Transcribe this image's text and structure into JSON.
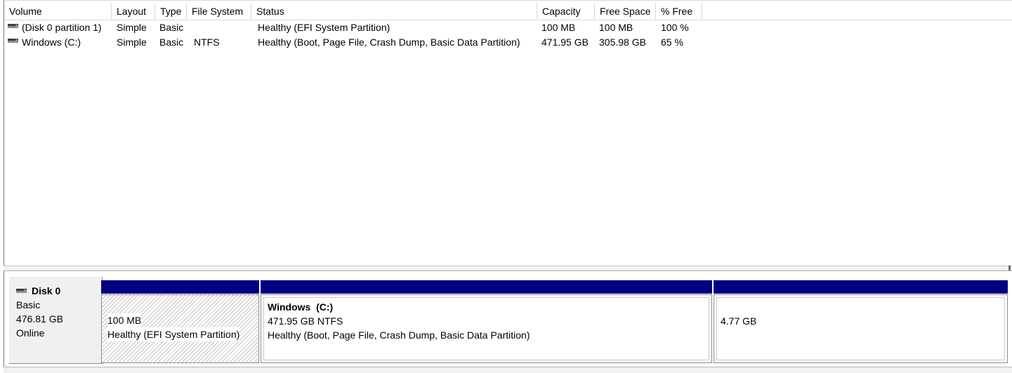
{
  "columns": {
    "volume": "Volume",
    "layout": "Layout",
    "type": "Type",
    "file_system": "File System",
    "status": "Status",
    "capacity": "Capacity",
    "free_space": "Free Space",
    "percent_free": "% Free"
  },
  "volumes": [
    {
      "volume": "(Disk 0 partition 1)",
      "layout": "Simple",
      "type": "Basic",
      "file_system": "",
      "status": "Healthy (EFI System Partition)",
      "capacity": "100 MB",
      "free_space": "100 MB",
      "percent_free": "100 %"
    },
    {
      "volume": "Windows (C:)",
      "layout": "Simple",
      "type": "Basic",
      "file_system": "NTFS",
      "status": "Healthy (Boot, Page File, Crash Dump, Basic Data Partition)",
      "capacity": "471.95 GB",
      "free_space": "305.98 GB",
      "percent_free": "65 %"
    }
  ],
  "disk": {
    "name": "Disk 0",
    "type": "Basic",
    "size": "476.81 GB",
    "state": "Online"
  },
  "partitions": [
    {
      "title": "",
      "size": "100 MB",
      "status": "Healthy (EFI System Partition)"
    },
    {
      "title": "Windows  (C:)",
      "size": "471.95 GB NTFS",
      "status": "Healthy (Boot, Page File, Crash Dump, Basic Data Partition)"
    },
    {
      "title": "",
      "size": "4.77 GB",
      "status": ""
    }
  ],
  "colors": {
    "partition_bar": "#000080",
    "window_bg": "#ffffff",
    "panel_bg": "#f0f0f0"
  }
}
